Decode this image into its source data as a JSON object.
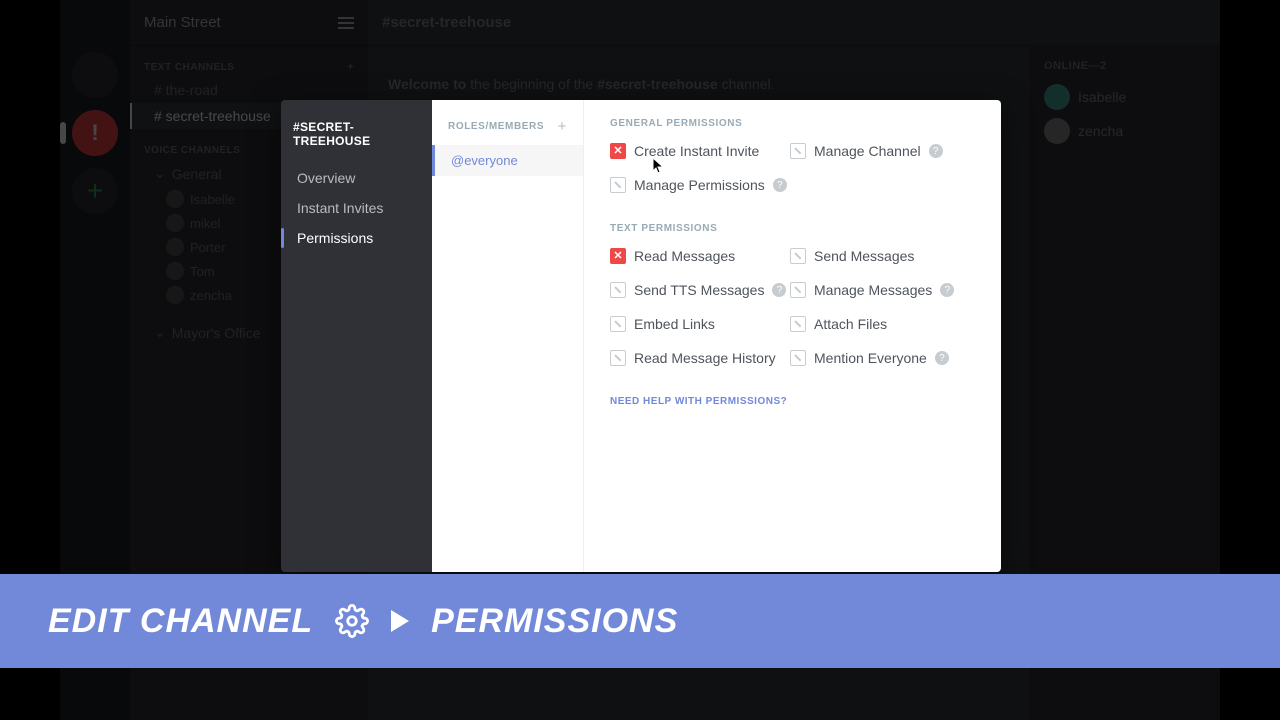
{
  "server": {
    "name": "Main Street"
  },
  "channels": {
    "text_category": "TEXT CHANNELS",
    "voice_category": "VOICE CHANNELS",
    "text": [
      {
        "name": "# the-road"
      },
      {
        "name": "# secret-treehouse"
      }
    ],
    "voice_group": "General",
    "voice_group2": "Mayor's Office",
    "voice_users": [
      "Isabelle",
      "mikel",
      "Porter",
      "Tom",
      "zencha"
    ]
  },
  "header": {
    "channel": "#secret-treehouse",
    "welcome_prefix": "Welcome to",
    "welcome_mid": " the beginning of the ",
    "welcome_bold": "#secret-treehouse",
    "welcome_suffix": " channel."
  },
  "members": {
    "heading": "ONLINE—2",
    "list": [
      "Isabelle",
      "zencha"
    ]
  },
  "modal": {
    "title": "#SECRET-TREEHOUSE",
    "nav": {
      "overview": "Overview",
      "invites": "Instant Invites",
      "permissions": "Permissions"
    },
    "roles_header": "ROLES/MEMBERS",
    "role_everyone": "@everyone",
    "section_general": "GENERAL PERMISSIONS",
    "section_text": "TEXT PERMISSIONS",
    "perms": {
      "create_invite": "Create Instant Invite",
      "manage_channel": "Manage Channel",
      "manage_permissions": "Manage Permissions",
      "read_messages": "Read Messages",
      "send_messages": "Send Messages",
      "send_tts": "Send TTS Messages",
      "manage_messages": "Manage Messages",
      "embed_links": "Embed Links",
      "attach_files": "Attach Files",
      "read_history": "Read Message History",
      "mention_everyone": "Mention Everyone"
    },
    "help_link": "NEED HELP WITH PERMISSIONS?"
  },
  "banner": {
    "edit_channel": "EDIT CHANNEL",
    "permissions": "PERMISSIONS"
  }
}
